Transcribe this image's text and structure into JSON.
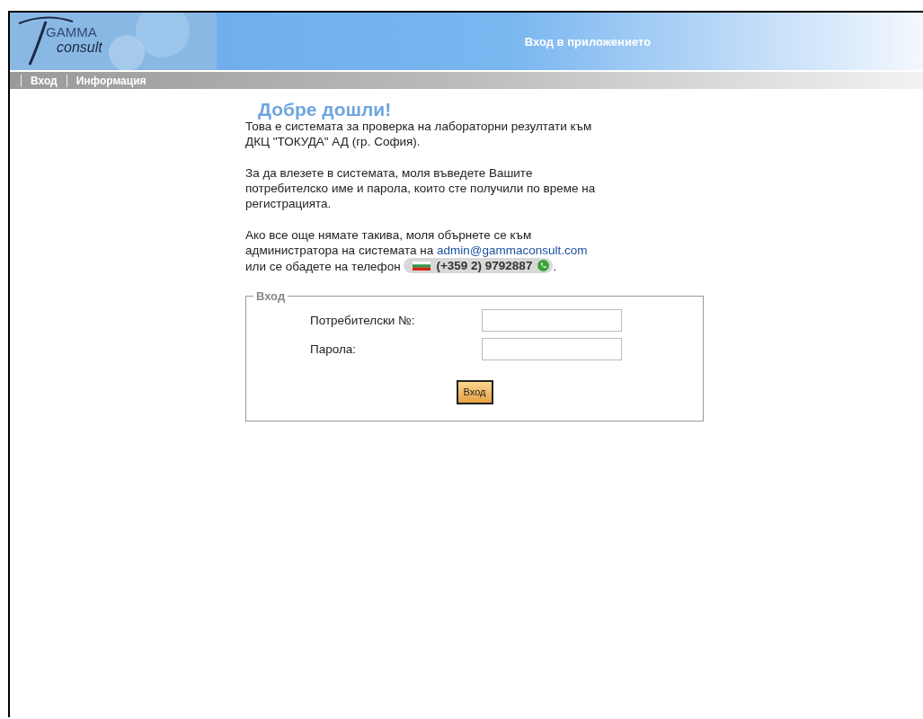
{
  "logo": {
    "line1": "GAMMA",
    "line2": "consult"
  },
  "header": {
    "title": "Вход в приложението"
  },
  "nav": [
    {
      "label": "Вход"
    },
    {
      "label": "Информация"
    }
  ],
  "welcome": "Добре дошли!",
  "paragraphs": [
    "Това е системата за проверка на лабораторни резултати към ДКЦ \"ТОКУДА\" АД (гр. София).",
    "За да влезете в системата, моля въведете Вашите потребителско име и парола, които сте получили по време на регистрацията."
  ],
  "contact": {
    "before": "Ако все още нямате такива, моля обърнете се към администратора на системата на",
    "email": "admin@gammaconsult.com",
    "middle": "или се обадете на телефон",
    "phone": "(+359 2) 9792887",
    "after": "."
  },
  "login": {
    "legend": "Вход",
    "fields": [
      {
        "label": "Потребителски №:"
      },
      {
        "label": "Парола:"
      }
    ],
    "button": "Вход"
  }
}
